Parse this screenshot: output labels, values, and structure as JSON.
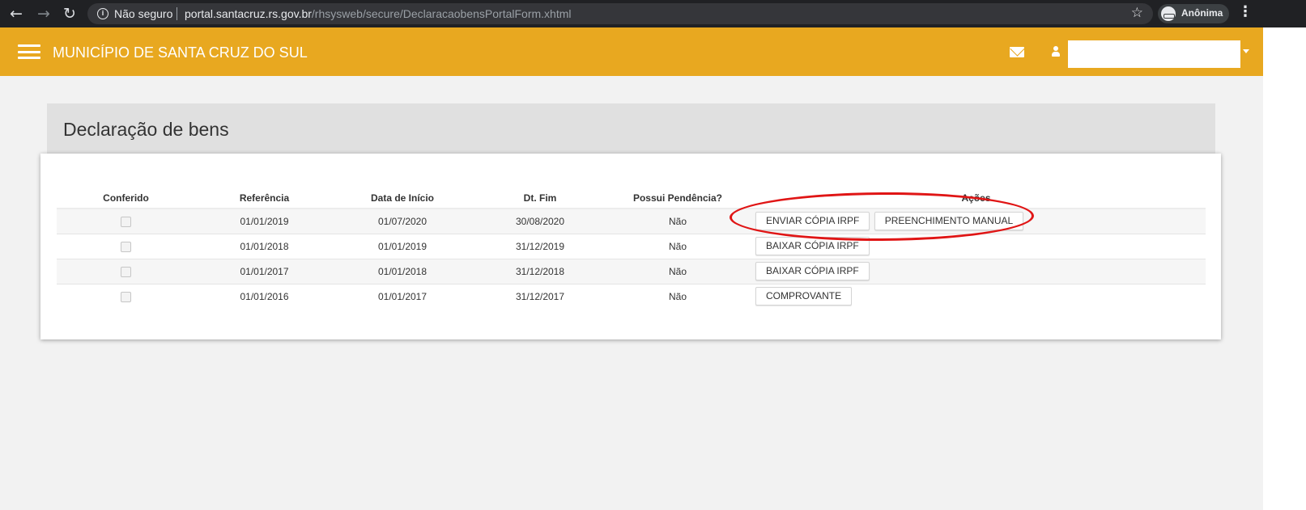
{
  "browser": {
    "security_label": "Não seguro",
    "url_host": "portal.santacruz.rs.gov.br",
    "url_path": "/rhsysweb/secure/DeclaracaobensPortalForm.xhtml",
    "profile_label": "Anônima",
    "icons": [
      "back-icon",
      "forward-icon",
      "reload-icon",
      "info-icon",
      "star-icon",
      "incognito-icon",
      "kebab-menu-icon"
    ]
  },
  "header": {
    "title": "MUNICÍPIO DE SANTA CRUZ DO SUL",
    "background": "#e8a820",
    "icons": [
      "hamburger-icon",
      "mail-icon",
      "user-icon",
      "caret-down-icon"
    ]
  },
  "page": {
    "title": "Declaração de bens"
  },
  "table": {
    "columns": [
      "Conferido",
      "Referência",
      "Data de Início",
      "Dt. Fim",
      "Possui Pendência?",
      "Ações"
    ],
    "rows": [
      {
        "conferido": false,
        "referencia": "01/01/2019",
        "inicio": "01/07/2020",
        "fim": "30/08/2020",
        "pendencia": "Não",
        "actions": [
          "ENVIAR CÓPIA IRPF",
          "PREENCHIMENTO MANUAL"
        ]
      },
      {
        "conferido": false,
        "referencia": "01/01/2018",
        "inicio": "01/01/2019",
        "fim": "31/12/2019",
        "pendencia": "Não",
        "actions": [
          "BAIXAR CÓPIA IRPF"
        ]
      },
      {
        "conferido": false,
        "referencia": "01/01/2017",
        "inicio": "01/01/2018",
        "fim": "31/12/2018",
        "pendencia": "Não",
        "actions": [
          "BAIXAR CÓPIA IRPF"
        ]
      },
      {
        "conferido": false,
        "referencia": "01/01/2016",
        "inicio": "01/01/2017",
        "fim": "31/12/2017",
        "pendencia": "Não",
        "actions": [
          "COMPROVANTE"
        ]
      }
    ]
  },
  "annotation": {
    "color": "#e01515"
  }
}
